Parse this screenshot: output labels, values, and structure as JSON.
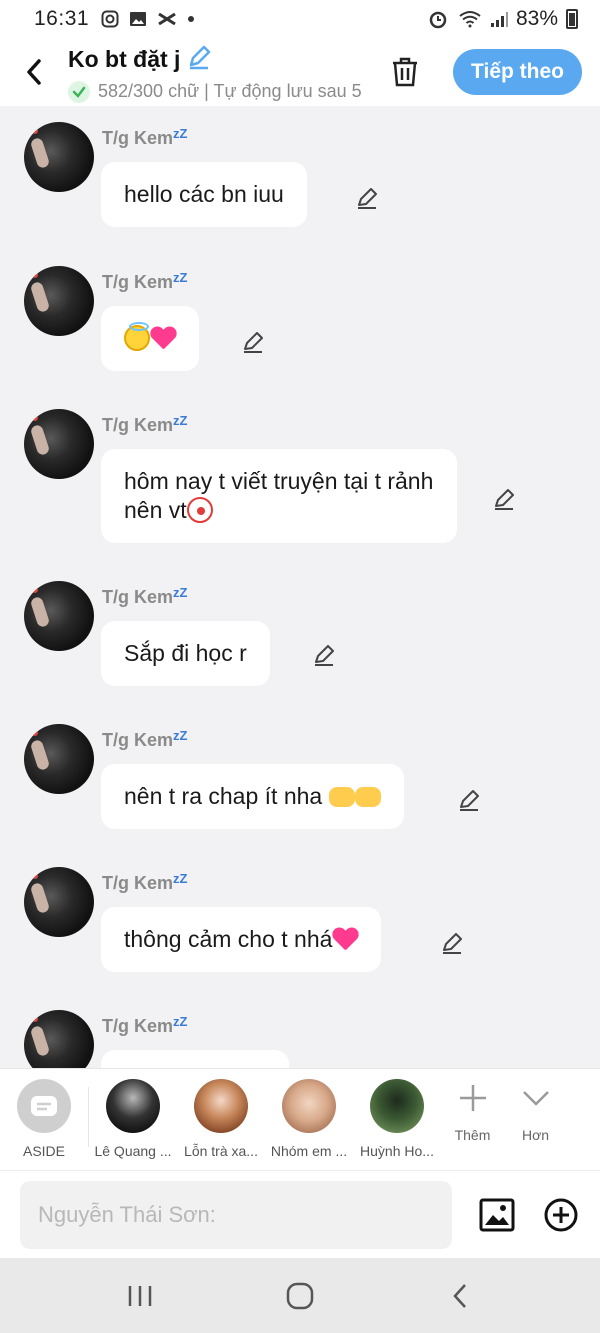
{
  "status_bar": {
    "time": "16:31",
    "battery": "83%",
    "icons": [
      "instagram-icon",
      "image-icon",
      "capcut-icon",
      "dot-icon",
      "alarm-icon",
      "wifi-icon",
      "signal-icon",
      "battery-icon"
    ]
  },
  "header": {
    "title": "Ko bt đặt j",
    "subtitle": "582/300 chữ | Tự động lưu sau 5",
    "next_label": "Tiếp theo",
    "accent": "#5aa9f0"
  },
  "messages": [
    {
      "sender": "T/g Kem",
      "text": "hello các bn iuu",
      "emoji": []
    },
    {
      "sender": "T/g Kem",
      "text": "",
      "emoji": [
        "emoji-halo",
        "emoji-heart"
      ]
    },
    {
      "sender": "T/g Kem",
      "text": "hôm nay t viết truyện tại t rảnh nên vt",
      "emoji": [
        "emoji-clown"
      ]
    },
    {
      "sender": "T/g Kem",
      "text": "Sắp đi học r",
      "emoji": []
    },
    {
      "sender": "T/g Kem",
      "text": "nên t ra chap ít nha",
      "emoji": [
        "emoji-point",
        "emoji-point"
      ]
    },
    {
      "sender": "T/g Kem",
      "text": "thông cảm cho t nhá",
      "emoji": [
        "emoji-heart"
      ]
    },
    {
      "sender": "T/g Kem",
      "text": "",
      "emoji": []
    }
  ],
  "sender_suffix": "zZ",
  "contacts": [
    {
      "name": "ASIDE"
    },
    {
      "name": "Lê Quang ..."
    },
    {
      "name": "Lỗn trà xa..."
    },
    {
      "name": "Nhóm em ..."
    },
    {
      "name": "Huỳnh Ho..."
    }
  ],
  "tools": {
    "add_label": "Thêm",
    "more_label": "Hơn"
  },
  "input": {
    "placeholder": "Nguyễn Thái Sơn:"
  }
}
